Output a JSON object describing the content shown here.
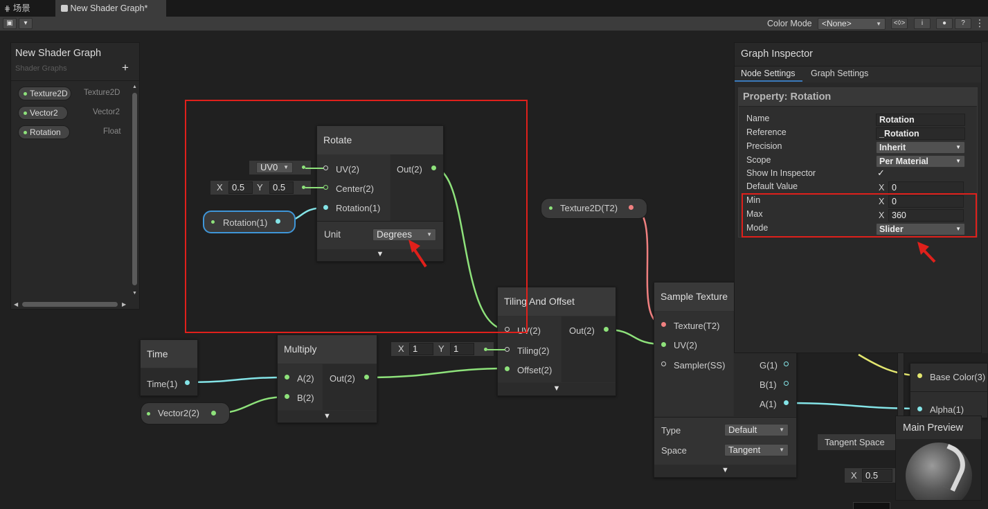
{
  "tabs": [
    {
      "label": "场景",
      "icon": "grid-icon"
    },
    {
      "label": "New Shader Graph*",
      "icon": "shader-graph-icon"
    }
  ],
  "toolbar": {
    "color_mode_label": "Color Mode",
    "color_mode_value": "<None>"
  },
  "blackboard": {
    "title": "New Shader Graph",
    "subtitle": "Shader Graphs",
    "add": "+",
    "properties": [
      {
        "name": "Texture2D",
        "type": "Texture2D"
      },
      {
        "name": "Vector2",
        "type": "Vector2"
      },
      {
        "name": "Rotation",
        "type": "Float"
      }
    ]
  },
  "rotate_node": {
    "title": "Rotate",
    "inputs": [
      "UV(2)",
      "Center(2)",
      "Rotation(1)"
    ],
    "output": "Out(2)",
    "uv_select": "UV0",
    "center_x_label": "X",
    "center_x": "0.5",
    "center_y_label": "Y",
    "center_y": "0.5",
    "unit_label": "Unit",
    "unit_value": "Degrees"
  },
  "rotation_property_node": {
    "label": "Rotation(1)"
  },
  "texture_property_node": {
    "label": "Texture2D(T2)"
  },
  "vector2_property_node": {
    "label": "Vector2(2)"
  },
  "time_node": {
    "title": "Time",
    "output": "Time(1)"
  },
  "multiply_node": {
    "title": "Multiply",
    "inputs": [
      "A(2)",
      "B(2)"
    ],
    "output": "Out(2)"
  },
  "tiling_node": {
    "title": "Tiling And Offset",
    "inputs": [
      "UV(2)",
      "Tiling(2)",
      "Offset(2)"
    ],
    "output": "Out(2)",
    "tiling_x_label": "X",
    "tiling_x": "1",
    "tiling_y_label": "Y",
    "tiling_y": "1"
  },
  "sample_texture_node": {
    "title": "Sample Texture",
    "inputs": [
      "Texture(T2)",
      "UV(2)",
      "Sampler(SS)"
    ],
    "outputs": [
      "G(1)",
      "B(1)",
      "A(1)"
    ],
    "type_label": "Type",
    "type_value": "Default",
    "space_label": "Space",
    "space_value": "Tangent"
  },
  "master_stack": {
    "base_color": "Base Color(3)",
    "alpha": "Alpha(1)"
  },
  "tangent_space_label": "Tangent Space",
  "bottom_x_label": "X",
  "bottom_x_value": "0.5",
  "main_preview": {
    "title": "Main Preview"
  },
  "inspector": {
    "title": "Graph Inspector",
    "tabs": [
      "Node Settings",
      "Graph Settings"
    ],
    "section_title": "Property: Rotation",
    "rows": {
      "name_label": "Name",
      "name_value": "Rotation",
      "reference_label": "Reference",
      "reference_value": "_Rotation",
      "precision_label": "Precision",
      "precision_value": "Inherit",
      "scope_label": "Scope",
      "scope_value": "Per Material",
      "show_label": "Show In Inspector",
      "show_value": "✓",
      "default_label": "Default Value",
      "default_x": "X",
      "default_value": "0",
      "min_label": "Min",
      "min_x": "X",
      "min_value": "0",
      "max_label": "Max",
      "max_x": "X",
      "max_value": "360",
      "mode_label": "Mode",
      "mode_value": "Slider"
    }
  },
  "colors": {
    "vector_wire": "#8ee27b",
    "float_wire": "#84e4e7",
    "texture_wire": "#f08080",
    "color_wire": "#e3e66f",
    "annotation": "#e0201b"
  }
}
